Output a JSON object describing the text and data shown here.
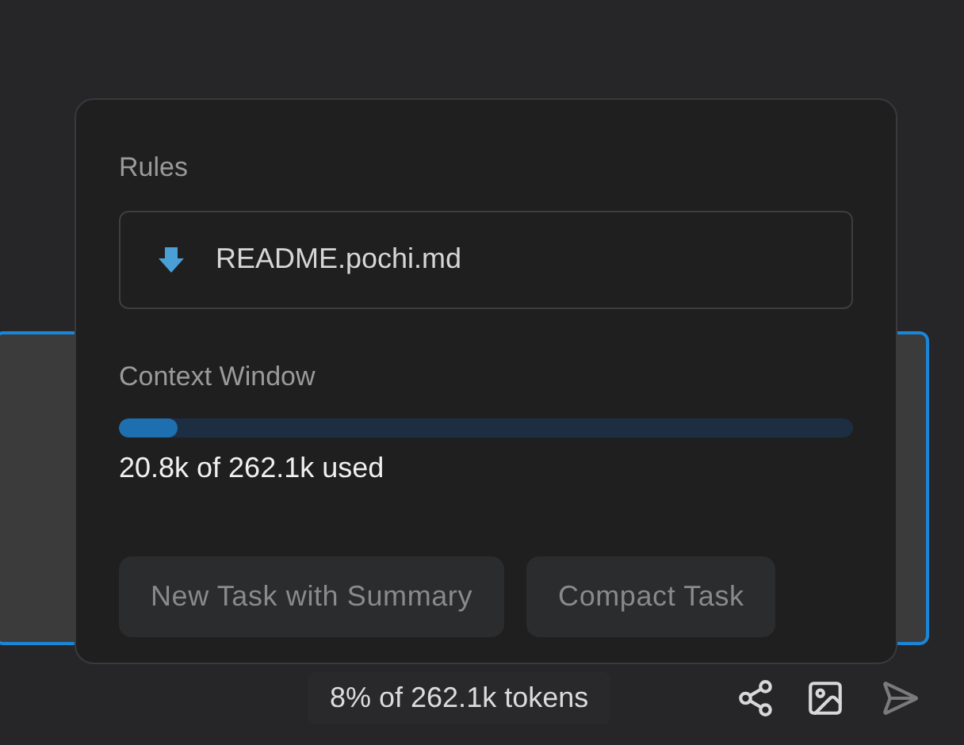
{
  "popover": {
    "rules_heading": "Rules",
    "rules": [
      {
        "name": "README.pochi.md"
      }
    ],
    "context_heading": "Context Window",
    "context": {
      "level": 0.08,
      "usage": "20.8k of 262.1k used"
    },
    "buttons": [
      {
        "label": "New Task with Summary",
        "disabled": true
      },
      {
        "label": "Compact Task",
        "disabled": true
      }
    ]
  },
  "footer": {
    "tokens": "8% of 262.1k tokens",
    "send_disabled": true
  }
}
